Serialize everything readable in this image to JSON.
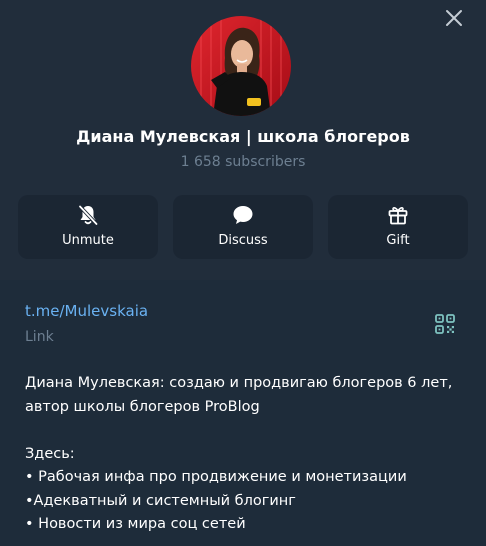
{
  "channel": {
    "title": "Диана Мулевская | школа блогеров",
    "subscribers": "1 658 subscribers"
  },
  "actions": [
    {
      "label": "Unmute",
      "icon": "bell-muted-icon"
    },
    {
      "label": "Discuss",
      "icon": "chat-bubble-icon"
    },
    {
      "label": "Gift",
      "icon": "gift-icon"
    }
  ],
  "info": {
    "link": "t.me/Mulevskaia",
    "link_label": "Link",
    "description": [
      "Диана Мулевская: создаю и продвигаю блогеров 6 лет,",
      "автор школы блогеров ProBlog",
      "",
      "Здесь:",
      "• Рабочая инфа про продвижение и монетизации",
      "•Адекватный и системный блогинг",
      "• Новости из мира соц сетей"
    ]
  },
  "colors": {
    "background": "#1e2c3a",
    "header_background": "#212d3b",
    "button_background": "#1b2633",
    "link": "#6ab2f2",
    "muted_text": "#6d7f91",
    "avatar_red": "#c8141e"
  }
}
